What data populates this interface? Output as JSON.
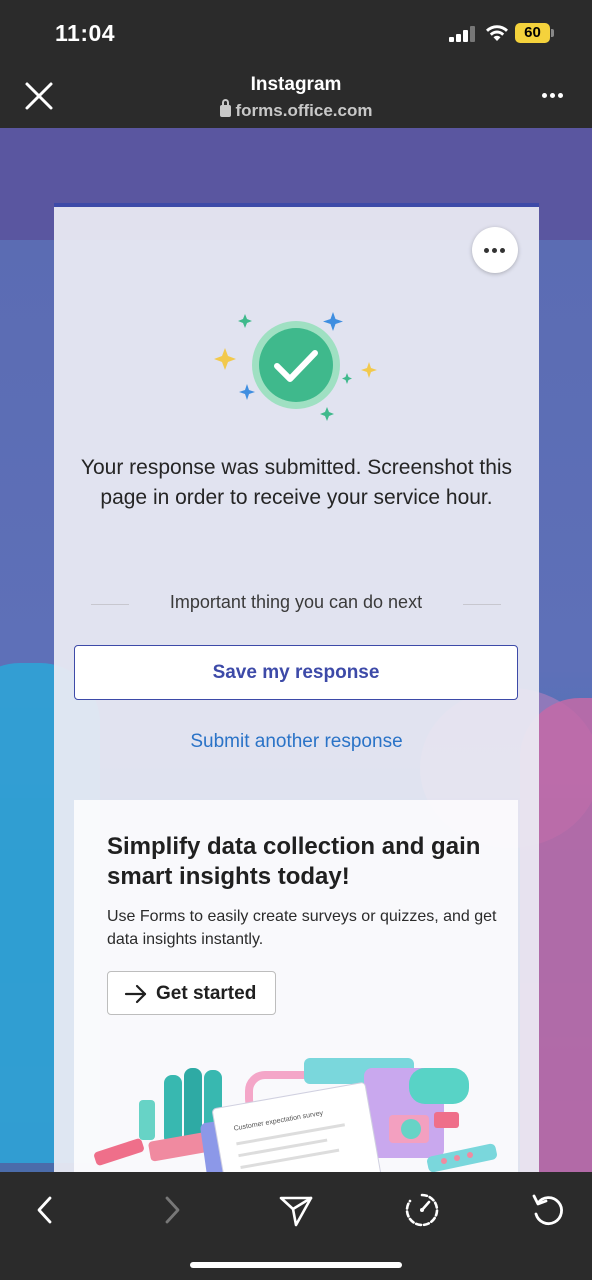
{
  "status_bar": {
    "time": "11:04",
    "battery": "60"
  },
  "browser": {
    "title": "Instagram",
    "url": "forms.office.com",
    "icons": [
      "close-icon",
      "more-icon",
      "lock-icon"
    ]
  },
  "form": {
    "submitted_message": "Your response was submitted. Screenshot this page in order to receive your service hour.",
    "next_label": "Important thing you can do next",
    "save_button": "Save my response",
    "submit_another": "Submit another response",
    "accent_color": "#3d4aa8",
    "link_color": "#2a73c7",
    "success_color": "#3fb98c"
  },
  "promo": {
    "title": "Simplify data collection and gain smart insights today!",
    "description": "Use Forms to easily create surveys or quizzes, and get data insights instantly.",
    "cta": "Get started",
    "illustration_text": "Customer expectation survey"
  },
  "nav": {
    "icons": [
      "back-icon",
      "forward-icon",
      "share-icon",
      "compass-icon",
      "refresh-icon"
    ]
  }
}
